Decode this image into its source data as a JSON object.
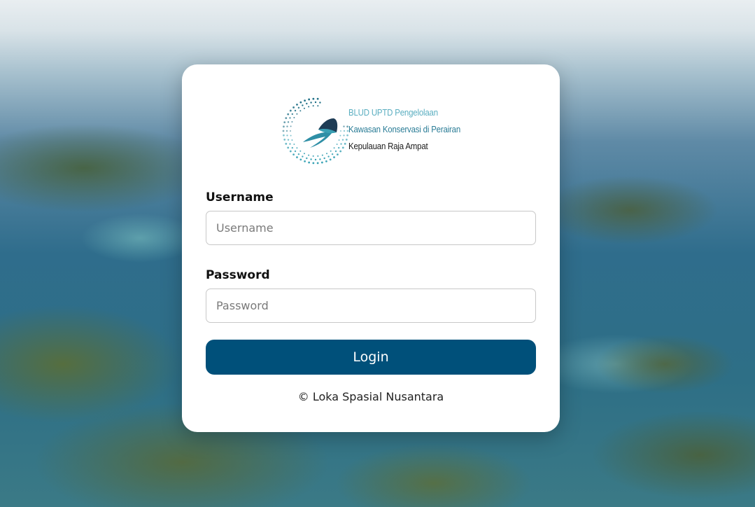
{
  "logo": {
    "icon": "manta-ray-logo-icon",
    "line1": "BLUD UPTD Pengelolaan",
    "line2": "Kawasan Konservasi di Perairan",
    "line3": "Kepulauan Raja Ampat",
    "colors": {
      "teal_light": "#5aaec0",
      "teal_dark": "#2a7c96",
      "navy": "#1e3c55"
    }
  },
  "form": {
    "username_label": "Username",
    "username_placeholder": "Username",
    "password_label": "Password",
    "password_placeholder": "Password",
    "login_label": "Login",
    "login_color": "#00507a"
  },
  "footer": {
    "text": "© Loka Spasial Nusantara"
  },
  "background": {
    "image": "aerial-islands-background"
  }
}
